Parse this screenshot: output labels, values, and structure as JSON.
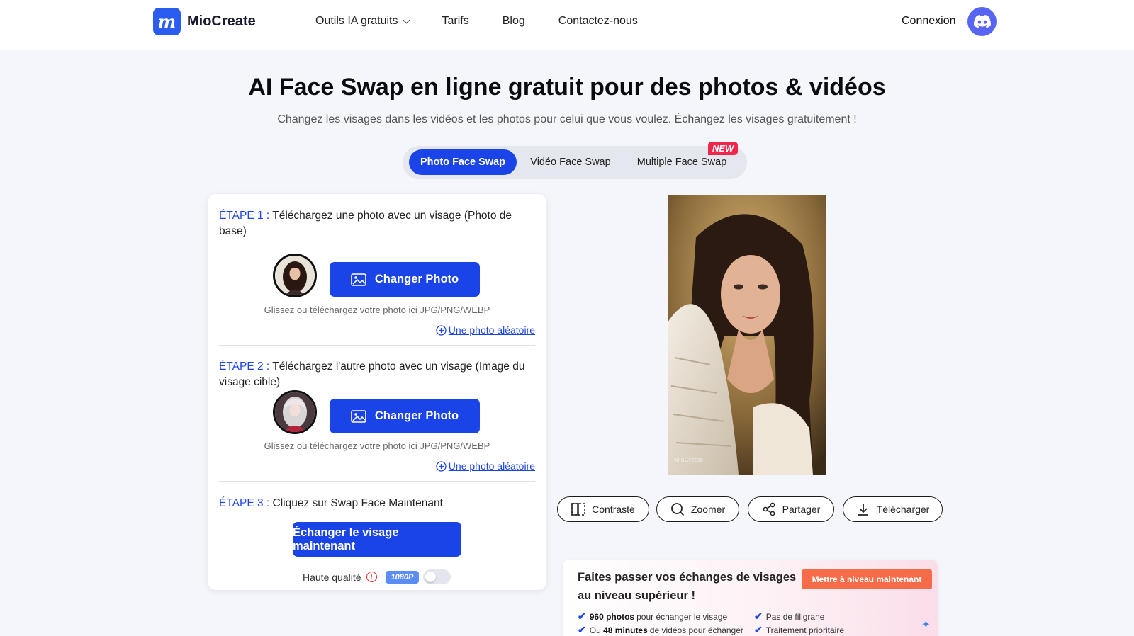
{
  "header": {
    "logo_letter": "m",
    "logo_text": "MioCreate",
    "nav": [
      "Outils IA gratuits",
      "Tarifs",
      "Blog",
      "Contactez-nous"
    ],
    "login": "Connexion"
  },
  "hero": {
    "title": "AI Face Swap en ligne gratuit pour des photos & vidéos",
    "subtitle": "Changez les visages dans les vidéos et les photos pour celui que vous voulez. Échangez les visages gratuitement !"
  },
  "tabs": {
    "items": [
      "Photo Face Swap",
      "Vidéo Face Swap",
      "Multiple Face Swap"
    ],
    "active_index": 0,
    "new_badge": "NEW"
  },
  "steps": {
    "step1_label": "ÉTAPE 1 :",
    "step1_text": " Téléchargez une photo avec un visage (Photo de base)",
    "step2_label": "ÉTAPE 2 :",
    "step2_text": " Téléchargez l'autre photo avec un visage (Image du visage cible)",
    "step3_label": "ÉTAPE 3 :",
    "step3_text": " Cliquez sur Swap Face Maintenant",
    "change_photo": "Changer Photo",
    "upload_hint": "Glissez ou téléchargez votre photo ici JPG/PNG/WEBP",
    "random_photo": "Une photo aléatoire",
    "swap_button": "Échanger le visage maintenant",
    "quality_label": "Haute qualité",
    "quality_badge": "1080P",
    "quality_enabled": false
  },
  "preview": {
    "watermark": "MioCreate",
    "actions": [
      "Contraste",
      "Zoomer",
      "Partager",
      "Télécharger"
    ]
  },
  "upgrade": {
    "title": "Faites passer vos échanges de visages au niveau supérieur !",
    "button": "Mettre à niveau maintenant",
    "feature1_bold": "960 photos",
    "feature1_text": "pour échanger le visage",
    "feature2_pre": "Ou",
    "feature2_bold": "48 minutes",
    "feature2_text": "de vidéos pour échanger",
    "feature3": "Pas de filigrane",
    "feature4": "Traitement prioritaire"
  },
  "colors": {
    "primary": "#1b44e8",
    "badge_new": "#f0264a",
    "upgrade_button": "#f76c48",
    "discord": "#5865f2"
  },
  "icons": [
    "chevron-down-icon",
    "discord-icon",
    "image-icon",
    "plus-circle-icon",
    "info-icon",
    "contrast-icon",
    "search-icon",
    "share-icon",
    "download-icon",
    "check-icon",
    "sparkle-icon"
  ]
}
